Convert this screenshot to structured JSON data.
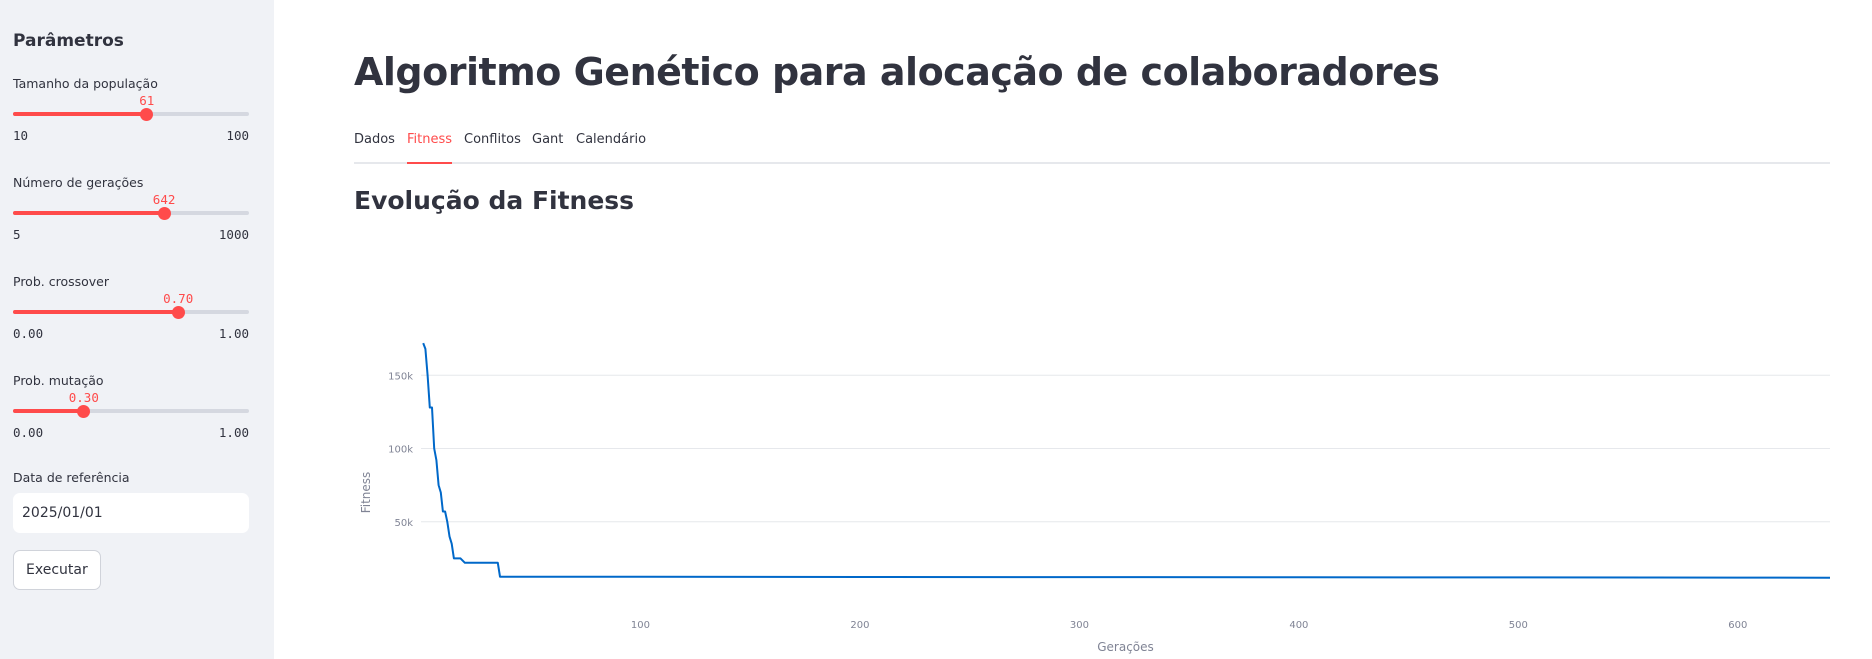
{
  "sidebar": {
    "title": "Parâmetros",
    "sliders": [
      {
        "label": "Tamanho da população",
        "min": 10,
        "max": 100,
        "value": 61,
        "min_label": "10",
        "max_label": "100",
        "value_label": "61"
      },
      {
        "label": "Número de gerações",
        "min": 5,
        "max": 1000,
        "value": 642,
        "min_label": "5",
        "max_label": "1000",
        "value_label": "642"
      },
      {
        "label": "Prob. crossover",
        "min": 0,
        "max": 1,
        "value": 0.7,
        "min_label": "0.00",
        "max_label": "1.00",
        "value_label": "0.70"
      },
      {
        "label": "Prob. mutação",
        "min": 0,
        "max": 1,
        "value": 0.3,
        "min_label": "0.00",
        "max_label": "1.00",
        "value_label": "0.30"
      }
    ],
    "date_label": "Data de referência",
    "date_value": "2025/01/01",
    "run_button": "Executar"
  },
  "main": {
    "title": "Algoritmo Genético para alocação de colaboradores",
    "tabs": [
      {
        "label": "Dados",
        "active": false
      },
      {
        "label": "Fitness",
        "active": true
      },
      {
        "label": "Conflitos",
        "active": false
      },
      {
        "label": "Gant",
        "active": false
      },
      {
        "label": "Calendário",
        "active": false
      }
    ],
    "section_title": "Evolução da Fitness"
  },
  "colors": {
    "accent": "#ff4b4b",
    "line": "#0068c9",
    "sidebar_bg": "#f0f2f6"
  },
  "chart_data": {
    "type": "line",
    "title": "",
    "xlabel": "Gerações",
    "ylabel": "Fitness",
    "xlim": [
      0,
      642
    ],
    "ylim": [
      0,
      170000
    ],
    "x_ticks": [
      100,
      200,
      300,
      400,
      500,
      600
    ],
    "x_tick_labels": [
      "100",
      "200",
      "300",
      "400",
      "500",
      "600"
    ],
    "y_ticks": [
      50000,
      100000,
      150000
    ],
    "y_tick_labels": [
      "50k",
      "100k",
      "150k"
    ],
    "grid": true,
    "series": [
      {
        "color": "#0068c9",
        "x": [
          1,
          2,
          3,
          4,
          5,
          6,
          7,
          8,
          9,
          10,
          11,
          12,
          13,
          14,
          15,
          16,
          17,
          18,
          20,
          25,
          30,
          35,
          36,
          100,
          200,
          300,
          400,
          500,
          600,
          642
        ],
        "y": [
          172000,
          168000,
          150000,
          128000,
          128000,
          100000,
          92000,
          75000,
          70000,
          57000,
          57000,
          50000,
          40000,
          35000,
          25000,
          25000,
          25000,
          25000,
          22000,
          22000,
          22000,
          22000,
          12500,
          12400,
          12300,
          12200,
          12100,
          12000,
          11900,
          11800
        ]
      }
    ]
  }
}
